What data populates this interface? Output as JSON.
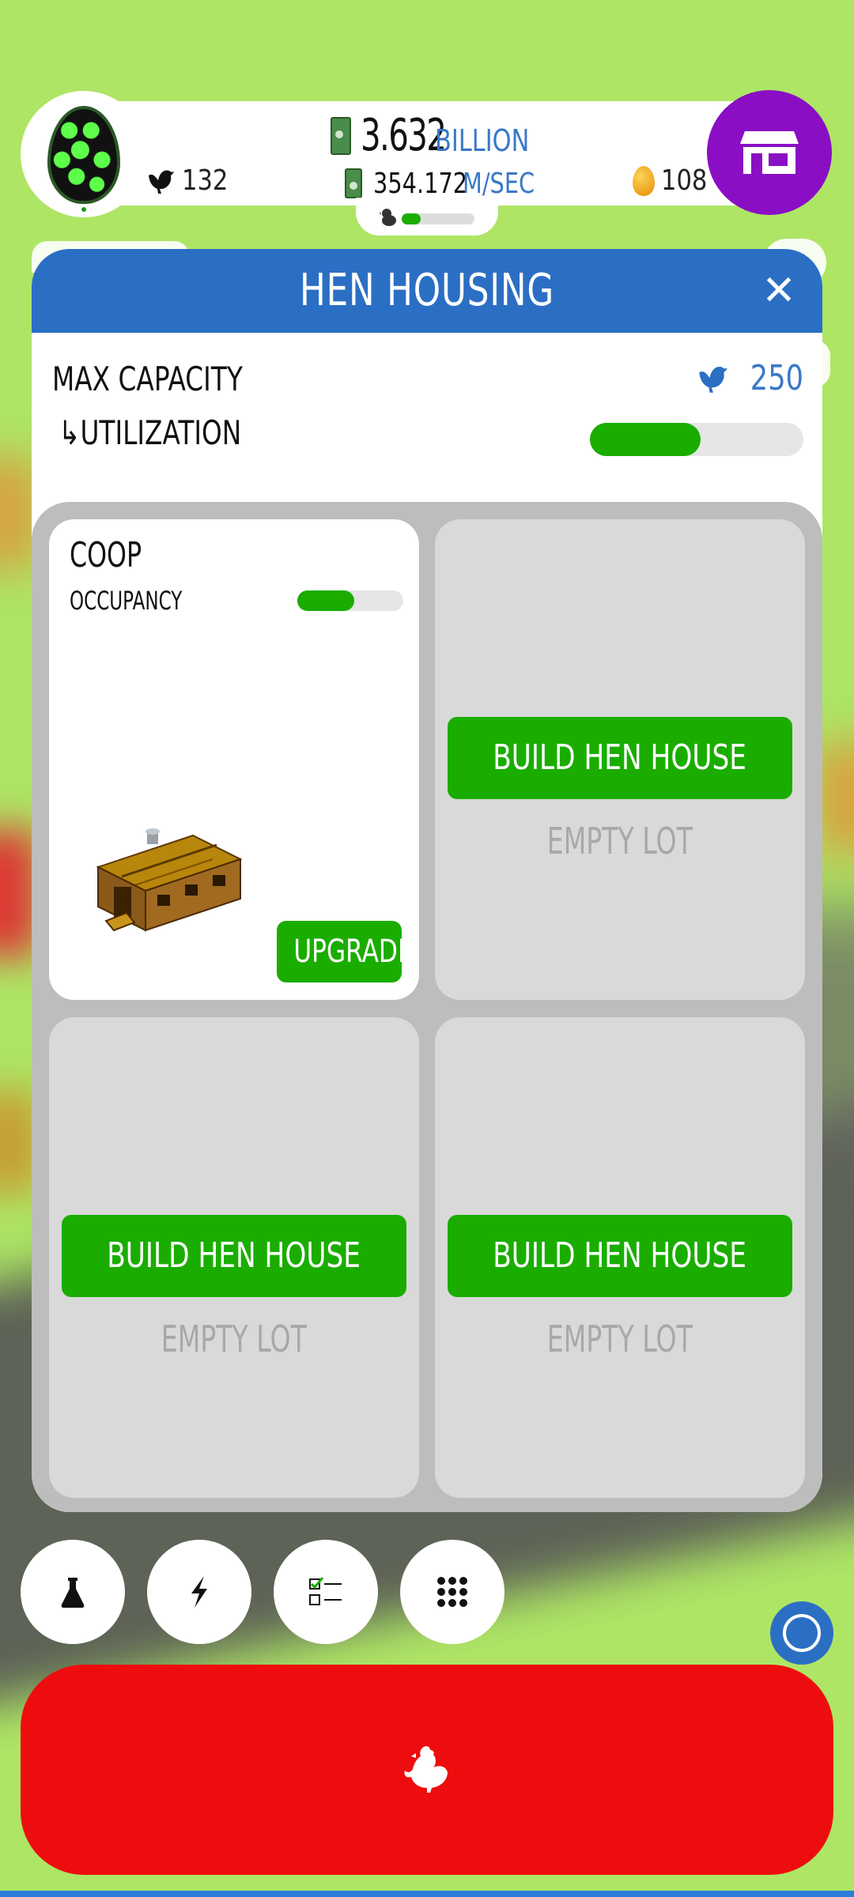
{
  "hud": {
    "money_value": "3.632",
    "money_unit": "BILLION",
    "rate_value": "354.172",
    "rate_unit": "M/SEC",
    "hen_count": "132",
    "golden_eggs": "108",
    "progress_fraction": 0.26
  },
  "dialog": {
    "title": "HEN HOUSING",
    "close_label": "✕",
    "max_capacity_label": "MAX CAPACITY",
    "max_capacity_value": "250",
    "utilization_label": "↳UTILIZATION",
    "utilization_fraction": 0.52,
    "lots": [
      {
        "name": "COOP",
        "occupancy_label": "OCCUPANCY",
        "occupancy_fraction": 0.54,
        "upgrade_label": "UPGRADE"
      },
      {
        "build_label": "BUILD HEN HOUSE",
        "status": "EMPTY LOT"
      },
      {
        "build_label": "BUILD HEN HOUSE",
        "status": "EMPTY LOT"
      },
      {
        "build_label": "BUILD HEN HOUSE",
        "status": "EMPTY LOT"
      }
    ]
  },
  "toolbar": {
    "icons": [
      "flask-icon",
      "lightning-icon",
      "checklist-icon",
      "grid-icon"
    ]
  },
  "colors": {
    "header_blue": "#2b6fc4",
    "button_green": "#1aad00",
    "shop_purple": "#8a0ec4",
    "hatch_red": "#ee0d0e"
  }
}
